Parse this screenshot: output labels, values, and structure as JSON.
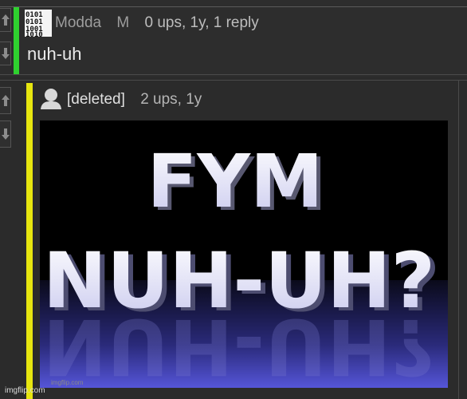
{
  "comments": [
    {
      "username": "Modda",
      "badge": "M",
      "stats": "0 ups, 1y, 1 reply",
      "body": "nuh-uh",
      "thread_color": "#2fd12f",
      "avatar_icon": "binary-avatar-icon"
    },
    {
      "username": "[deleted]",
      "stats": "2 ups, 1y",
      "thread_color": "#e7e60f",
      "avatar_icon": "person-silhouette-icon",
      "image": {
        "line1": "FYM",
        "line2": "NUH-UH?",
        "watermark": "imgflip.com"
      }
    }
  ],
  "vote": {
    "up_icon": "up-arrow-icon",
    "down_icon": "down-arrow-icon"
  },
  "footer_watermark": "imgflip.com"
}
